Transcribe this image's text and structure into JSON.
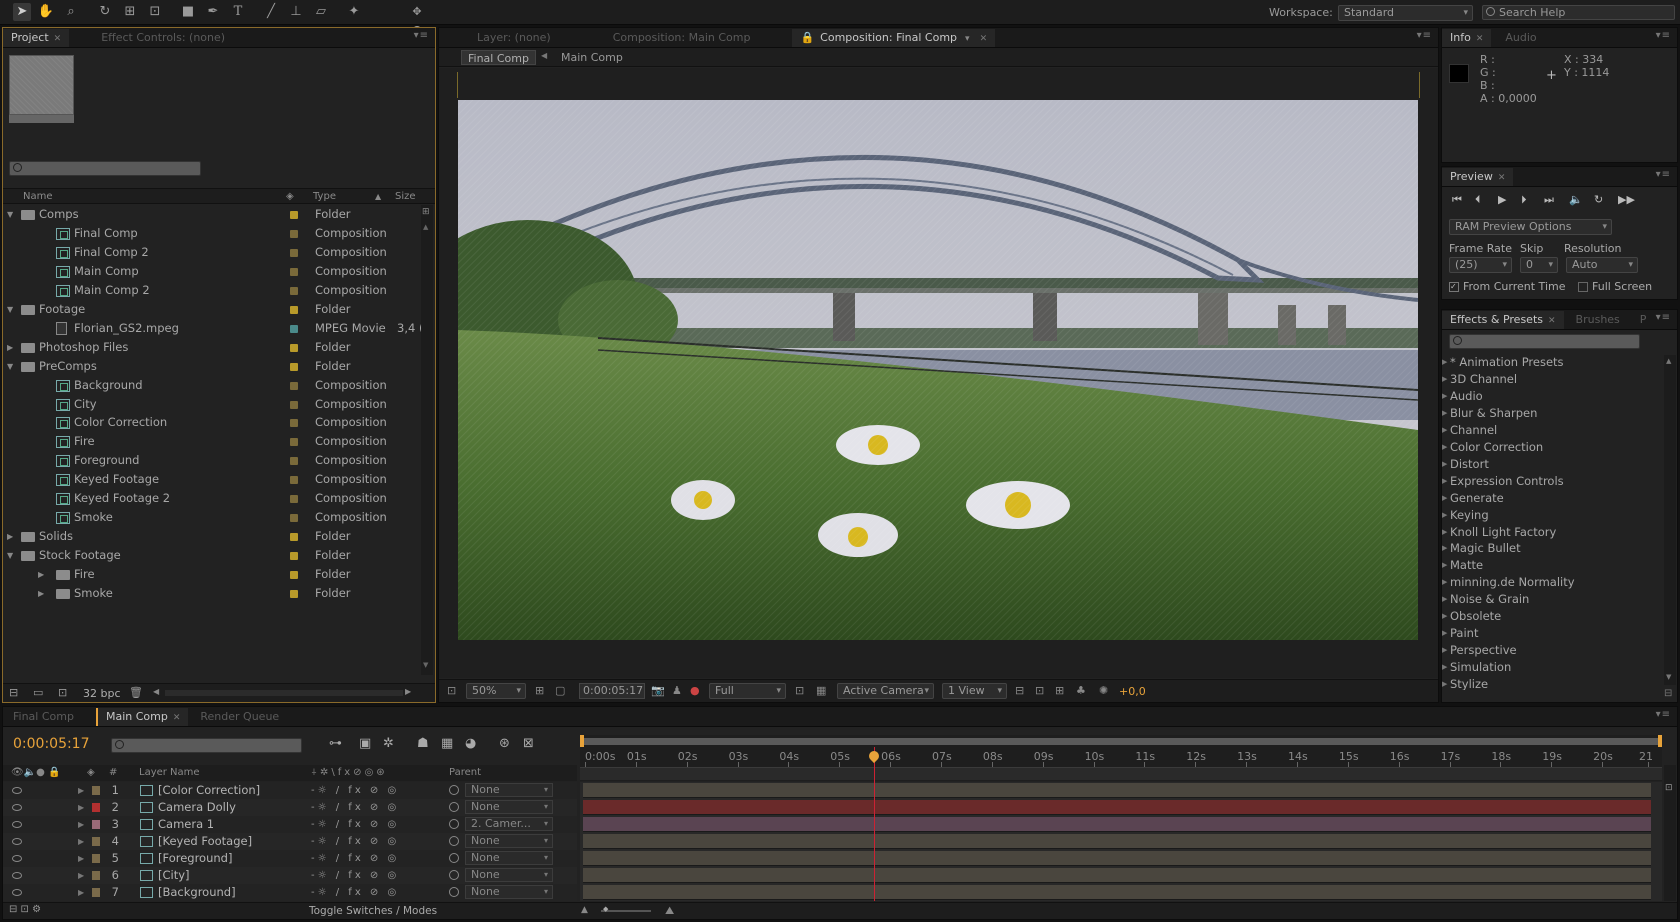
{
  "toolbar": {
    "tools": [
      "selection-tool",
      "hand-tool",
      "zoom-tool",
      "rotation-tool",
      "camera-tool",
      "pan-behind-tool",
      "rectangle-tool",
      "pen-tool",
      "type-tool",
      "brush-tool",
      "clone-stamp-tool",
      "eraser-tool",
      "puppet-pin-tool"
    ],
    "workspace_label": "Workspace:",
    "workspace_value": "Standard",
    "search_help_placeholder": "Search Help"
  },
  "project_panel": {
    "tabs": [
      {
        "label": "Project",
        "active": true
      },
      {
        "label": "Effect Controls: (none)",
        "active": false
      }
    ],
    "columns": {
      "name": "Name",
      "type": "Type",
      "size": "Size"
    },
    "items": [
      {
        "level": 0,
        "kind": "folder",
        "name": "Comps",
        "type": "Folder",
        "open": true
      },
      {
        "level": 1,
        "kind": "comp",
        "name": "Final Comp",
        "type": "Composition"
      },
      {
        "level": 1,
        "kind": "comp",
        "name": "Final Comp 2",
        "type": "Composition"
      },
      {
        "level": 1,
        "kind": "comp",
        "name": "Main Comp",
        "type": "Composition"
      },
      {
        "level": 1,
        "kind": "comp",
        "name": "Main Comp 2",
        "type": "Composition"
      },
      {
        "level": 0,
        "kind": "folder",
        "name": "Footage",
        "type": "Folder",
        "open": true
      },
      {
        "level": 1,
        "kind": "movie",
        "name": "Florian_GS2.mpeg",
        "type": "MPEG Movie",
        "size": "3,4 ("
      },
      {
        "level": 0,
        "kind": "folder",
        "name": "Photoshop Files",
        "type": "Folder",
        "open": false
      },
      {
        "level": 0,
        "kind": "folder",
        "name": "PreComps",
        "type": "Folder",
        "open": true
      },
      {
        "level": 1,
        "kind": "comp",
        "name": "Background",
        "type": "Composition"
      },
      {
        "level": 1,
        "kind": "comp",
        "name": "City",
        "type": "Composition"
      },
      {
        "level": 1,
        "kind": "comp",
        "name": "Color Correction",
        "type": "Composition"
      },
      {
        "level": 1,
        "kind": "comp",
        "name": "Fire",
        "type": "Composition"
      },
      {
        "level": 1,
        "kind": "comp",
        "name": "Foreground",
        "type": "Composition"
      },
      {
        "level": 1,
        "kind": "comp",
        "name": "Keyed Footage",
        "type": "Composition"
      },
      {
        "level": 1,
        "kind": "comp",
        "name": "Keyed Footage 2",
        "type": "Composition"
      },
      {
        "level": 1,
        "kind": "comp",
        "name": "Smoke",
        "type": "Composition"
      },
      {
        "level": 0,
        "kind": "folder",
        "name": "Solids",
        "type": "Folder",
        "open": false
      },
      {
        "level": 0,
        "kind": "folder",
        "name": "Stock Footage",
        "type": "Folder",
        "open": true
      },
      {
        "level": 1,
        "kind": "folder",
        "name": "Fire",
        "type": "Folder",
        "open": false
      },
      {
        "level": 1,
        "kind": "folder",
        "name": "Smoke",
        "type": "Folder",
        "open": false
      }
    ],
    "bpc_label": "32 bpc"
  },
  "composition_panel": {
    "tabs": [
      {
        "label": "Layer: (none)",
        "active": false
      },
      {
        "label": "Composition: Main Comp",
        "active": false
      },
      {
        "label": "Composition: Final Comp",
        "active": true
      }
    ],
    "breadcrumbs": [
      "Final Comp",
      "Main Comp"
    ],
    "zoom": "50%",
    "timecode": "0:00:05:17",
    "resolution": "Full",
    "camera": "Active Camera",
    "views": "1 View",
    "exposure": "+0,0"
  },
  "info_panel": {
    "tabs": [
      {
        "label": "Info",
        "active": true
      },
      {
        "label": "Audio",
        "active": false
      }
    ],
    "r_label": "R :",
    "g_label": "G :",
    "b_label": "B :",
    "a_label": "A : 0,0000",
    "x_label": "X : 334",
    "y_label": "Y : 1114"
  },
  "preview_panel": {
    "tab": "Preview",
    "ram_options": "RAM Preview Options",
    "frame_rate_label": "Frame Rate",
    "frame_rate_value": "(25)",
    "skip_label": "Skip",
    "skip_value": "0",
    "resolution_label": "Resolution",
    "resolution_value": "Auto",
    "from_current_time": "From Current Time",
    "full_screen": "Full Screen"
  },
  "effects_panel": {
    "tabs": [
      {
        "label": "Effects & Presets",
        "active": true
      },
      {
        "label": "Brushes",
        "active": false
      },
      {
        "label": "P",
        "active": false
      }
    ],
    "items": [
      "* Animation Presets",
      "3D Channel",
      "Audio",
      "Blur & Sharpen",
      "Channel",
      "Color Correction",
      "Distort",
      "Expression Controls",
      "Generate",
      "Keying",
      "Knoll Light Factory",
      "Magic Bullet",
      "Matte",
      "minning.de Normality",
      "Noise & Grain",
      "Obsolete",
      "Paint",
      "Perspective",
      "Simulation",
      "Stylize"
    ]
  },
  "timeline": {
    "tabs": [
      {
        "label": "Final Comp",
        "active": false
      },
      {
        "label": "Main Comp",
        "active": true
      },
      {
        "label": "Render Queue",
        "active": false
      }
    ],
    "timecode": "0:00:05:17",
    "columns": {
      "layer_name": "Layer Name",
      "parent": "Parent",
      "number": "#"
    },
    "ruler": [
      "0:00s",
      "01s",
      "02s",
      "03s",
      "04s",
      "05s",
      "06s",
      "07s",
      "08s",
      "09s",
      "10s",
      "11s",
      "12s",
      "13s",
      "14s",
      "15s",
      "16s",
      "17s",
      "18s",
      "19s",
      "20s",
      "21"
    ],
    "playhead_seconds": 5.68,
    "duration_seconds": 21,
    "layers": [
      {
        "num": "1",
        "name": "[Color Correction]",
        "parent": "None",
        "label_color": "#7a6a4a",
        "bar_color": "#4a463e"
      },
      {
        "num": "2",
        "name": "Camera Dolly",
        "parent": "None",
        "label_color": "#b23030",
        "bar_color": "#6a2a2a"
      },
      {
        "num": "3",
        "name": "Camera 1",
        "parent": "2. Camer...",
        "label_color": "#9a6a78",
        "bar_color": "#5a4452"
      },
      {
        "num": "4",
        "name": "[Keyed Footage]",
        "parent": "None",
        "label_color": "#7a6a4a",
        "bar_color": "#4a463e"
      },
      {
        "num": "5",
        "name": "[Foreground]",
        "parent": "None",
        "label_color": "#7a6a4a",
        "bar_color": "#4a463e"
      },
      {
        "num": "6",
        "name": "[City]",
        "parent": "None",
        "label_color": "#7a6a4a",
        "bar_color": "#4a463e"
      },
      {
        "num": "7",
        "name": "[Background]",
        "parent": "None",
        "label_color": "#7a6a4a",
        "bar_color": "#4a463e"
      }
    ],
    "toggle_label": "Toggle Switches / Modes"
  },
  "colors": {
    "accent": "#e8a33a",
    "panel": "#222222",
    "label_yellow": "#b89a2a",
    "label_teal": "#4a8a8a"
  }
}
